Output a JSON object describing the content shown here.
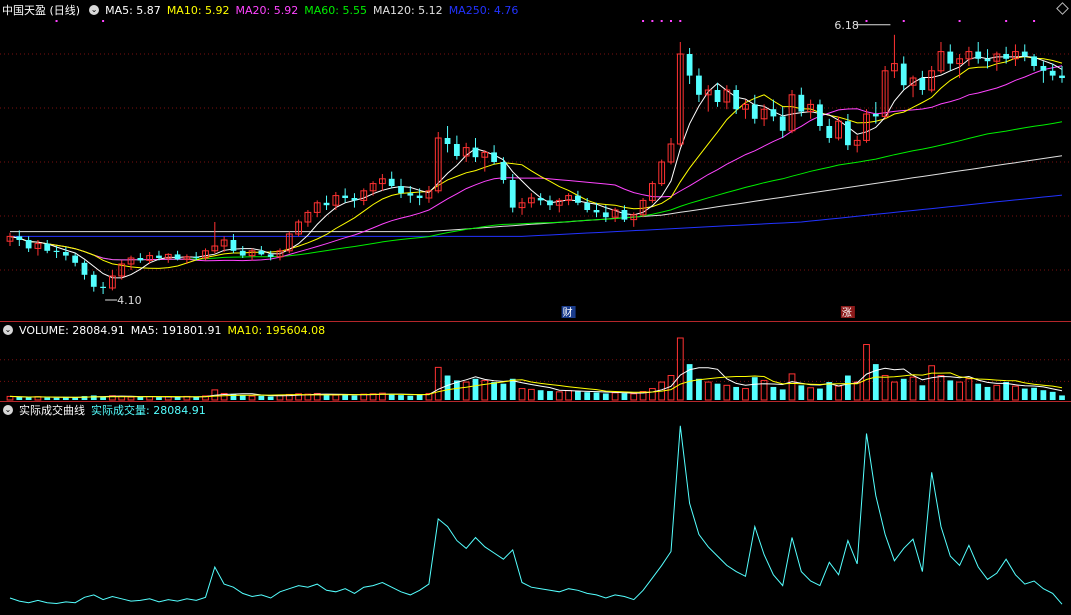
{
  "header": {
    "stock": "中国天盈 (日线)",
    "ma5": "MA5: 5.87",
    "ma10": "MA10: 5.92",
    "ma20": "MA20: 5.92",
    "ma60": "MA60: 5.55",
    "ma120": "MA120: 5.12",
    "ma250": "MA250: 4.76"
  },
  "volume_header": {
    "volume": "VOLUME: 28084.91",
    "ma5": "MA5: 191801.91",
    "ma10": "MA10: 195604.08"
  },
  "curve_header": {
    "name": "实际成交曲线",
    "value": "实际成交量: 28084.91"
  },
  "markers": {
    "cai": "财",
    "zhang": "涨"
  },
  "colors": {
    "up": "#ff3232",
    "down": "#54ffff",
    "ma5": "#ffffff",
    "ma10": "#ffff00",
    "ma20": "#ff44ff",
    "ma60": "#00ee00",
    "ma120": "#e0e0e0",
    "ma250": "#2233ff",
    "grid": "#7a1010",
    "curve": "#54ffff"
  },
  "chart_data": {
    "type": "candlestick",
    "price_range": [
      3.9,
      6.4
    ],
    "annotations": {
      "high": "6.18",
      "low": "4.10"
    },
    "candles": [
      [
        4.54,
        4.61,
        4.5,
        4.58
      ],
      [
        4.58,
        4.63,
        4.5,
        4.55
      ],
      [
        4.55,
        4.58,
        4.45,
        4.48
      ],
      [
        4.48,
        4.55,
        4.42,
        4.52
      ],
      [
        4.52,
        4.55,
        4.44,
        4.46
      ],
      [
        4.46,
        4.5,
        4.4,
        4.45
      ],
      [
        4.45,
        4.49,
        4.38,
        4.42
      ],
      [
        4.42,
        4.44,
        4.33,
        4.36
      ],
      [
        4.36,
        4.38,
        4.22,
        4.26
      ],
      [
        4.26,
        4.29,
        4.12,
        4.16
      ],
      [
        4.16,
        4.2,
        4.1,
        4.15
      ],
      [
        4.15,
        4.3,
        4.13,
        4.25
      ],
      [
        4.25,
        4.38,
        4.22,
        4.35
      ],
      [
        4.35,
        4.42,
        4.3,
        4.4
      ],
      [
        4.4,
        4.44,
        4.36,
        4.38
      ],
      [
        4.38,
        4.45,
        4.35,
        4.42
      ],
      [
        4.42,
        4.46,
        4.38,
        4.4
      ],
      [
        4.4,
        4.44,
        4.36,
        4.43
      ],
      [
        4.43,
        4.46,
        4.38,
        4.39
      ],
      [
        4.39,
        4.43,
        4.35,
        4.41
      ],
      [
        4.41,
        4.45,
        4.38,
        4.4
      ],
      [
        4.4,
        4.48,
        4.38,
        4.46
      ],
      [
        4.46,
        4.7,
        4.44,
        4.5
      ],
      [
        4.5,
        4.58,
        4.45,
        4.55
      ],
      [
        4.55,
        4.6,
        4.44,
        4.46
      ],
      [
        4.46,
        4.5,
        4.4,
        4.42
      ],
      [
        4.42,
        4.48,
        4.38,
        4.46
      ],
      [
        4.46,
        4.5,
        4.42,
        4.43
      ],
      [
        4.43,
        4.46,
        4.38,
        4.41
      ],
      [
        4.41,
        4.48,
        4.38,
        4.46
      ],
      [
        4.46,
        4.62,
        4.44,
        4.6
      ],
      [
        4.6,
        4.72,
        4.58,
        4.7
      ],
      [
        4.7,
        4.8,
        4.66,
        4.78
      ],
      [
        4.78,
        4.88,
        4.74,
        4.86
      ],
      [
        4.86,
        4.92,
        4.8,
        4.84
      ],
      [
        4.84,
        4.95,
        4.8,
        4.92
      ],
      [
        4.92,
        4.98,
        4.86,
        4.9
      ],
      [
        4.9,
        4.94,
        4.82,
        4.88
      ],
      [
        4.88,
        4.98,
        4.84,
        4.96
      ],
      [
        4.96,
        5.04,
        4.92,
        5.02
      ],
      [
        5.02,
        5.1,
        4.96,
        5.06
      ],
      [
        5.06,
        5.12,
        4.98,
        5.0
      ],
      [
        5.0,
        5.06,
        4.9,
        4.94
      ],
      [
        4.94,
        5.0,
        4.86,
        4.92
      ],
      [
        4.92,
        4.98,
        4.84,
        4.9
      ],
      [
        4.9,
        5.0,
        4.86,
        4.96
      ],
      [
        4.96,
        5.45,
        4.94,
        5.4
      ],
      [
        5.4,
        5.5,
        5.28,
        5.35
      ],
      [
        5.35,
        5.42,
        5.22,
        5.25
      ],
      [
        5.25,
        5.36,
        5.2,
        5.32
      ],
      [
        5.32,
        5.4,
        5.2,
        5.24
      ],
      [
        5.24,
        5.3,
        5.12,
        5.28
      ],
      [
        5.28,
        5.34,
        5.18,
        5.2
      ],
      [
        5.2,
        5.24,
        5.02,
        5.05
      ],
      [
        5.05,
        5.1,
        4.78,
        4.82
      ],
      [
        4.82,
        4.9,
        4.76,
        4.86
      ],
      [
        4.86,
        4.94,
        4.82,
        4.9
      ],
      [
        4.9,
        4.94,
        4.84,
        4.88
      ],
      [
        4.88,
        4.92,
        4.8,
        4.84
      ],
      [
        4.84,
        4.9,
        4.78,
        4.88
      ],
      [
        4.88,
        4.94,
        4.84,
        4.92
      ],
      [
        4.92,
        4.96,
        4.84,
        4.86
      ],
      [
        4.86,
        4.9,
        4.78,
        4.8
      ],
      [
        4.8,
        4.86,
        4.74,
        4.78
      ],
      [
        4.78,
        4.84,
        4.7,
        4.74
      ],
      [
        4.74,
        4.82,
        4.7,
        4.8
      ],
      [
        4.8,
        4.84,
        4.7,
        4.72
      ],
      [
        4.72,
        4.78,
        4.66,
        4.76
      ],
      [
        4.76,
        4.9,
        4.74,
        4.88
      ],
      [
        4.88,
        5.04,
        4.86,
        5.02
      ],
      [
        5.02,
        5.22,
        5.0,
        5.2
      ],
      [
        5.2,
        5.4,
        5.18,
        5.35
      ],
      [
        5.35,
        6.2,
        5.33,
        6.1
      ],
      [
        6.1,
        6.15,
        5.85,
        5.92
      ],
      [
        5.92,
        5.98,
        5.7,
        5.76
      ],
      [
        5.76,
        5.84,
        5.62,
        5.8
      ],
      [
        5.8,
        5.86,
        5.66,
        5.7
      ],
      [
        5.7,
        5.84,
        5.64,
        5.8
      ],
      [
        5.8,
        5.84,
        5.6,
        5.64
      ],
      [
        5.64,
        5.72,
        5.56,
        5.68
      ],
      [
        5.68,
        5.76,
        5.52,
        5.56
      ],
      [
        5.56,
        5.68,
        5.5,
        5.64
      ],
      [
        5.64,
        5.72,
        5.54,
        5.58
      ],
      [
        5.58,
        5.66,
        5.4,
        5.46
      ],
      [
        5.46,
        5.8,
        5.44,
        5.76
      ],
      [
        5.76,
        5.82,
        5.58,
        5.62
      ],
      [
        5.62,
        5.72,
        5.56,
        5.68
      ],
      [
        5.68,
        5.72,
        5.46,
        5.5
      ],
      [
        5.5,
        5.56,
        5.36,
        5.4
      ],
      [
        5.4,
        5.58,
        5.38,
        5.54
      ],
      [
        5.54,
        5.6,
        5.3,
        5.34
      ],
      [
        5.34,
        5.42,
        5.28,
        5.38
      ],
      [
        5.38,
        5.64,
        5.36,
        5.6
      ],
      [
        5.6,
        5.7,
        5.52,
        5.58
      ],
      [
        5.58,
        6.0,
        5.56,
        5.96
      ],
      [
        5.96,
        6.26,
        5.9,
        6.02
      ],
      [
        6.02,
        6.08,
        5.8,
        5.84
      ],
      [
        5.84,
        5.92,
        5.74,
        5.9
      ],
      [
        5.9,
        5.96,
        5.76,
        5.8
      ],
      [
        5.8,
        6.0,
        5.78,
        5.96
      ],
      [
        5.96,
        6.2,
        5.94,
        6.12
      ],
      [
        6.12,
        6.18,
        5.96,
        6.02
      ],
      [
        6.02,
        6.1,
        5.9,
        6.06
      ],
      [
        6.06,
        6.16,
        6.0,
        6.12
      ],
      [
        6.12,
        6.2,
        6.02,
        6.06
      ],
      [
        6.06,
        6.14,
        5.98,
        6.04
      ],
      [
        6.04,
        6.12,
        5.96,
        6.1
      ],
      [
        6.1,
        6.16,
        6.02,
        6.06
      ],
      [
        6.06,
        6.18,
        6.0,
        6.12
      ],
      [
        6.12,
        6.18,
        6.04,
        6.08
      ],
      [
        6.08,
        6.1,
        5.96,
        6.0
      ],
      [
        6.0,
        6.04,
        5.86,
        5.96
      ],
      [
        5.96,
        6.02,
        5.88,
        5.92
      ],
      [
        5.92,
        6.0,
        5.86,
        5.9
      ]
    ],
    "volume_range": [
      0,
      380000
    ],
    "volume": [
      22000,
      18000,
      16000,
      20000,
      15000,
      14000,
      17000,
      15000,
      24000,
      28000,
      20000,
      26000,
      22000,
      18000,
      19000,
      21000,
      17000,
      20000,
      18000,
      22000,
      19000,
      25000,
      62000,
      40000,
      35000,
      28000,
      24000,
      26000,
      22000,
      30000,
      34000,
      38000,
      36000,
      40000,
      32000,
      30000,
      34000,
      28000,
      36000,
      38000,
      42000,
      36000,
      30000,
      26000,
      32000,
      40000,
      200000,
      150000,
      120000,
      110000,
      130000,
      120000,
      110000,
      100000,
      130000,
      70000,
      65000,
      60000,
      55000,
      50000,
      58000,
      54000,
      48000,
      46000,
      40000,
      44000,
      42000,
      38000,
      52000,
      70000,
      110000,
      150000,
      380000,
      220000,
      130000,
      110000,
      100000,
      90000,
      80000,
      70000,
      140000,
      120000,
      80000,
      65000,
      160000,
      90000,
      75000,
      70000,
      110000,
      85000,
      150000,
      110000,
      340000,
      220000,
      150000,
      110000,
      130000,
      140000,
      90000,
      210000,
      150000,
      120000,
      110000,
      130000,
      100000,
      80000,
      90000,
      110000,
      85000,
      70000,
      75000,
      60000,
      50000,
      28000
    ],
    "volume_ma5_value": 191801.91,
    "volume_ma10_value": 195604.08,
    "actual_volume": [
      18000,
      14000,
      12000,
      15000,
      12000,
      11000,
      13000,
      12000,
      19000,
      22000,
      16000,
      20000,
      17000,
      14000,
      15000,
      17000,
      13000,
      16000,
      14000,
      17000,
      15000,
      19000,
      58000,
      36000,
      32000,
      24000,
      20000,
      22000,
      18000,
      26000,
      30000,
      34000,
      32000,
      36000,
      28000,
      26000,
      30000,
      24000,
      32000,
      34000,
      38000,
      32000,
      26000,
      22000,
      28000,
      36000,
      120000,
      110000,
      92000,
      82000,
      96000,
      84000,
      76000,
      68000,
      80000,
      38000,
      32000,
      30000,
      28000,
      26000,
      30000,
      28000,
      24000,
      22000,
      18000,
      22000,
      20000,
      16000,
      28000,
      44000,
      60000,
      78000,
      240000,
      140000,
      100000,
      84000,
      72000,
      60000,
      52000,
      46000,
      110000,
      74000,
      48000,
      34000,
      96000,
      52000,
      40000,
      34000,
      64000,
      48000,
      92000,
      62000,
      230000,
      150000,
      100000,
      66000,
      82000,
      94000,
      52000,
      180000,
      110000,
      72000,
      60000,
      86000,
      58000,
      42000,
      50000,
      68000,
      48000,
      36000,
      40000,
      30000,
      24000,
      10000
    ]
  }
}
